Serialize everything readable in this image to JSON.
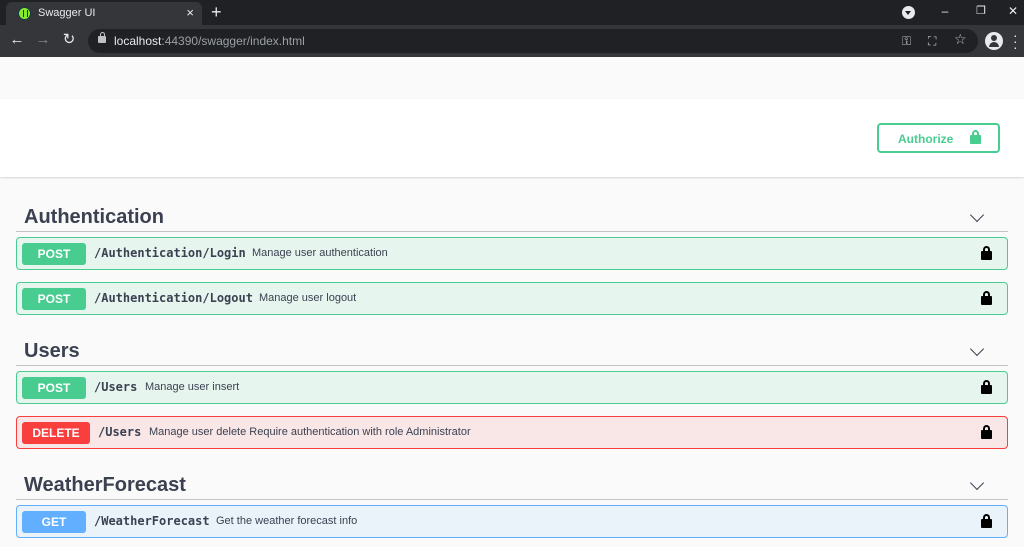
{
  "browser": {
    "tab_title": "Swagger UI",
    "tab_close": "×",
    "new_tab": "+",
    "url_host": "localhost",
    "url_rest": ":44390/swagger/index.html",
    "icons": [
      "back-arrow-icon",
      "forward-arrow-icon",
      "reload-icon",
      "lock-icon",
      "key-icon",
      "translate-icon",
      "star-icon",
      "profile-icon",
      "menu-icon"
    ],
    "window_controls": {
      "minimize": "–",
      "maximize": "❐",
      "close": "✕"
    }
  },
  "authorize": {
    "label": "Authorize",
    "color": "#49cc90"
  },
  "tags": [
    {
      "name": "Authentication",
      "operations": [
        {
          "method": "POST",
          "path": "/Authentication/Login",
          "summary": "Manage user authentication"
        },
        {
          "method": "POST",
          "path": "/Authentication/Logout",
          "summary": "Manage user logout"
        }
      ]
    },
    {
      "name": "Users",
      "operations": [
        {
          "method": "POST",
          "path": "/Users",
          "summary": "Manage user insert"
        },
        {
          "method": "DELETE",
          "path": "/Users",
          "summary": "Manage user delete Require authentication with role Administrator"
        }
      ]
    },
    {
      "name": "WeatherForecast",
      "operations": [
        {
          "method": "GET",
          "path": "/WeatherForecast",
          "summary": "Get the weather forecast info"
        }
      ]
    }
  ],
  "method_colors": {
    "POST": "#49cc90",
    "DELETE": "#f93e3e",
    "GET": "#61affe"
  }
}
